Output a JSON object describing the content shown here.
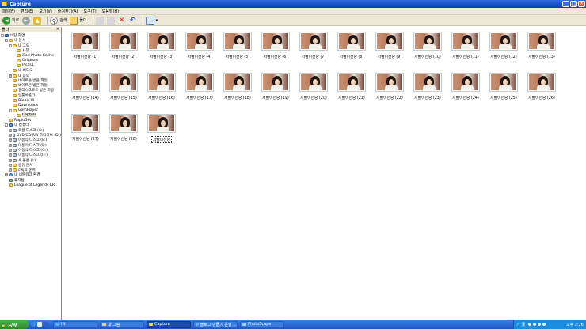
{
  "window": {
    "title": "Capture"
  },
  "menubar": {
    "items": [
      "파일(F)",
      "편집(E)",
      "보기(V)",
      "즐겨찾기(A)",
      "도구(T)",
      "도움말(H)"
    ]
  },
  "toolbar": {
    "back_label": "뒤로",
    "search_label": "검색",
    "folders_label": "폴더"
  },
  "folders_pane": {
    "header": "폴더",
    "close": "×",
    "tree": [
      {
        "label": "바탕 화면",
        "icon": "desktop-icon",
        "depth": 0,
        "expand": "-"
      },
      {
        "label": "내 문서",
        "icon": "folder-icon",
        "depth": 1,
        "expand": "-"
      },
      {
        "label": "내 그림",
        "icon": "folder-icon",
        "depth": 2,
        "expand": "-"
      },
      {
        "label": "사진",
        "icon": "folder-icon",
        "depth": 3,
        "expand": ""
      },
      {
        "label": "iPod Photo Cache",
        "icon": "folder-icon",
        "depth": 3,
        "expand": ""
      },
      {
        "label": "Originals",
        "icon": "folder-icon",
        "depth": 3,
        "expand": ""
      },
      {
        "label": "Picasa",
        "icon": "folder-icon",
        "depth": 3,
        "expand": ""
      },
      {
        "label": "내 비디오",
        "icon": "folder-icon",
        "depth": 2,
        "expand": ""
      },
      {
        "label": "내 음악",
        "icon": "folder-icon",
        "depth": 2,
        "expand": "+"
      },
      {
        "label": "네이트온 받은 파일",
        "icon": "folder-icon",
        "depth": 2,
        "expand": ""
      },
      {
        "label": "네이트온 받은 파일",
        "icon": "folder-icon",
        "depth": 2,
        "expand": ""
      },
      {
        "label": "웹디스크로드 받은 파일",
        "icon": "folder-icon",
        "depth": 2,
        "expand": ""
      },
      {
        "label": "알툴바폴더",
        "icon": "folder-icon",
        "depth": 2,
        "expand": ""
      },
      {
        "label": "Diablo III",
        "icon": "folder-icon",
        "depth": 2,
        "expand": ""
      },
      {
        "label": "Downloads",
        "icon": "folder-icon",
        "depth": 2,
        "expand": ""
      },
      {
        "label": "GomPlayer",
        "icon": "folder-icon",
        "depth": 2,
        "expand": "-"
      },
      {
        "label": "Capture",
        "icon": "folder-icon",
        "depth": 3,
        "expand": "",
        "selected": true
      },
      {
        "label": "RapidGet",
        "icon": "folder-icon",
        "depth": 1,
        "expand": ""
      },
      {
        "label": "내 컴퓨터",
        "icon": "computer-icon",
        "depth": 1,
        "expand": "-"
      },
      {
        "label": "로컬 디스크 (C:)",
        "icon": "drive-icon",
        "depth": 2,
        "expand": "+"
      },
      {
        "label": "DVD/CD-RW 드라이브 (D:)",
        "icon": "drive-icon",
        "depth": 2,
        "expand": "+"
      },
      {
        "label": "이동식 디스크 (E:)",
        "icon": "drive-icon",
        "depth": 2,
        "expand": "+"
      },
      {
        "label": "이동식 디스크 (F:)",
        "icon": "drive-icon",
        "depth": 2,
        "expand": "+"
      },
      {
        "label": "이동식 디스크 (G:)",
        "icon": "drive-icon",
        "depth": 2,
        "expand": "+"
      },
      {
        "label": "이동식 디스크 (H:)",
        "icon": "drive-icon",
        "depth": 2,
        "expand": "+"
      },
      {
        "label": "새 볼륨 (I:)",
        "icon": "drive-icon",
        "depth": 2,
        "expand": "+"
      },
      {
        "label": "공유 문서",
        "icon": "folder-icon",
        "depth": 2,
        "expand": "+"
      },
      {
        "label": "cwj의 문서",
        "icon": "folder-icon",
        "depth": 2,
        "expand": "+"
      },
      {
        "label": "내 네트워크 환경",
        "icon": "network-icon",
        "depth": 1,
        "expand": "+"
      },
      {
        "label": "휴지통",
        "icon": "recycle-bin-icon",
        "depth": 1,
        "expand": ""
      },
      {
        "label": "League of Legends KR",
        "icon": "folder-icon",
        "depth": 1,
        "expand": ""
      }
    ]
  },
  "files": [
    "저빨이선냥 (1)",
    "저빨이선냥 (2)",
    "저빨이선냥 (3)",
    "저빨이선냥 (4)",
    "저빨이선냥 (5)",
    "저빨이선냥 (6)",
    "저빨이선냥 (7)",
    "저빨이선냥 (8)",
    "저빨이선냥 (9)",
    "저빨이선냥 (10)",
    "저빨이선냥 (11)",
    "저빨이선냥 (12)",
    "저빨이선냥 (13)",
    "저빨이선냥 (14)",
    "저빨이선냥 (15)",
    "저빨이선냥 (16)",
    "저빨이선냥 (17)",
    "저빨이선냥 (18)",
    "저빨이선냥 (19)",
    "저빨이선냥 (20)",
    "저빨이선냥 (21)",
    "저빨이선냥 (22)",
    "저빨이선냥 (23)",
    "저빨이선냥 (24)",
    "저빨이선냥 (25)",
    "저빨이선냥 (26)",
    "저빨이선냥 (27)",
    "저빨이선냥 (28)",
    "저빨이선냥"
  ],
  "taskbar": {
    "start_label": "시작",
    "tasks": [
      {
        "label": "Ht",
        "icon": "ie"
      },
      {
        "label": "내 그림",
        "icon": "folder"
      },
      {
        "label": "Capture",
        "icon": "folder",
        "active": true
      },
      {
        "label": "블로그 만들기 운영 ...",
        "icon": "ie"
      },
      {
        "label": "PhotoScape",
        "icon": "ps"
      }
    ],
    "ime": "가 漢",
    "clock": "오후 2:26"
  }
}
